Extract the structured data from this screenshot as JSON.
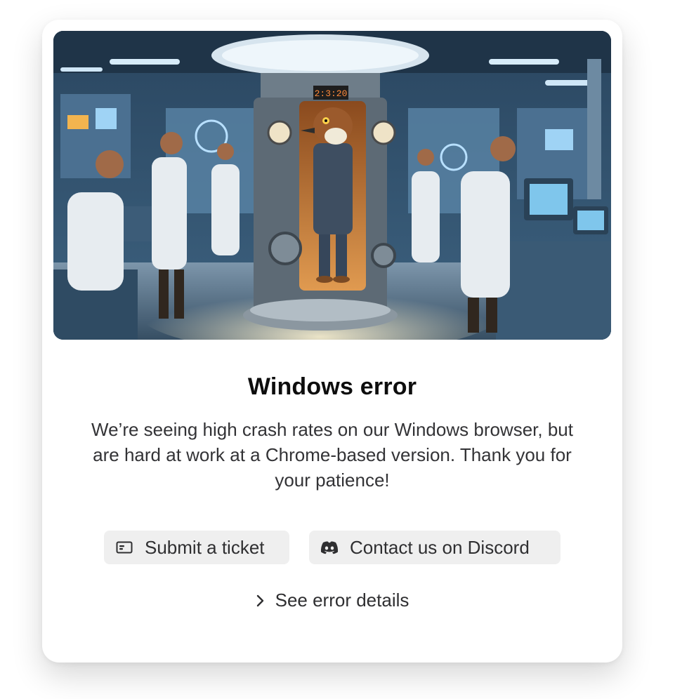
{
  "hero": {
    "clock_text": "2:3:20",
    "icon": "lab-illustration"
  },
  "error": {
    "title": "Windows error",
    "description": "We’re seeing high crash rates on our Windows browser, but are hard at work at a Chrome-based version. Thank you for your patience!"
  },
  "actions": {
    "ticket_label": "Submit a ticket",
    "ticket_icon": "ticket-icon",
    "discord_label": "Contact us on Discord",
    "discord_icon": "discord-icon",
    "details_label": "See error details",
    "details_icon": "chevron-right-icon"
  },
  "colors": {
    "button_bg": "#efefef",
    "title": "#0d0d0d",
    "text": "#333336"
  }
}
